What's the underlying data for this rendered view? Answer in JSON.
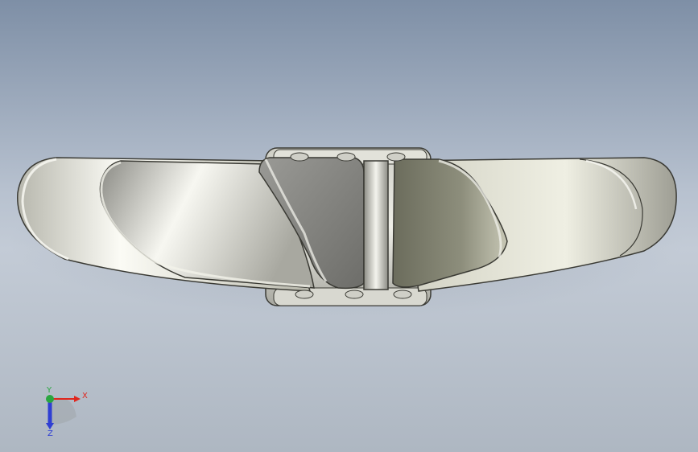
{
  "scene": {
    "background_top": "#7e8fa6",
    "background_bottom": "#c3cbd6",
    "model_colors": {
      "metal_light": "#f4f4ee",
      "metal_mid": "#c8c8bc",
      "metal_dark": "#6c6c62",
      "edge": "#3a3a34"
    }
  },
  "triad": {
    "x_label": "X",
    "y_label": "Y",
    "z_label": "Z",
    "x_color": "#e0261d",
    "y_color": "#2aa640",
    "z_color": "#2f3fd3"
  }
}
